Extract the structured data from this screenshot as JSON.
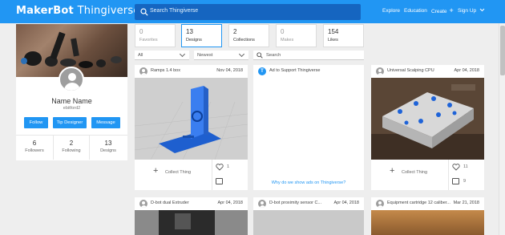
{
  "brand": {
    "name_bold": "MakerBot",
    "name_thin": "Thingiverse"
  },
  "search": {
    "placeholder": "Search Thingiverse"
  },
  "nav": {
    "explore": "Explore",
    "education": "Education",
    "create": "Create",
    "signup": "Sign Up"
  },
  "colors": {
    "primary": "#2196f3",
    "search_bg": "#1565c0",
    "link": "#2196f3"
  },
  "profile": {
    "name": "Name Name",
    "username": "ebitford2",
    "buttons": {
      "follow": "Follow",
      "tip": "Tip Designer",
      "message": "Message"
    },
    "stats": [
      {
        "value": "6",
        "label": "Followers"
      },
      {
        "value": "2",
        "label": "Following"
      },
      {
        "value": "13",
        "label": "Designs"
      }
    ]
  },
  "counters": [
    {
      "value": "0",
      "label": "Favorites"
    },
    {
      "value": "13",
      "label": "Designs"
    },
    {
      "value": "2",
      "label": "Collections"
    },
    {
      "value": "0",
      "label": "Makes"
    },
    {
      "value": "154",
      "label": "Likes"
    }
  ],
  "filters": {
    "type": "All",
    "sort": "Newest",
    "search_placeholder": "Search"
  },
  "cards": [
    {
      "title": "Ramps 1.4 box",
      "date": "Nov 04, 2018",
      "collect": "Collect Thing",
      "likes": "1",
      "comments": ""
    },
    {
      "title": "Ad to Support Thingiverse",
      "link": "Why do we show ads on Thingiverse?"
    },
    {
      "title": "Universal Scalping CPU",
      "date": "Apr 04, 2018",
      "collect": "Collect Thing",
      "likes": "11",
      "comments": "9"
    },
    {
      "title": "D-bot dual Extruder",
      "date": "Apr 04, 2018"
    },
    {
      "title": "D-bot proximity sensor C...",
      "date": "Apr 04, 2018"
    },
    {
      "title": "Equipment cartridge 12 caliber...",
      "date": "Mar 21, 2018"
    }
  ]
}
